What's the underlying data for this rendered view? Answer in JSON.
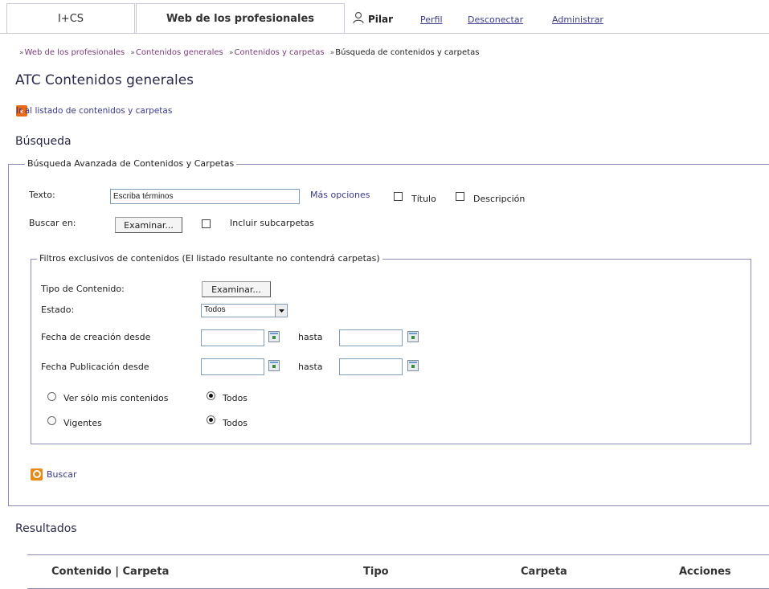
{
  "tabs": [
    {
      "label": "I+CS",
      "active": false
    },
    {
      "label": "Web de los profesionales",
      "active": true
    }
  ],
  "user": {
    "icon": "user-icon",
    "name": "Pilar"
  },
  "top_links": {
    "profile": "Perfil",
    "logout": "Desconectar",
    "admin": "Administrar"
  },
  "breadcrumb": {
    "separator": "»",
    "items": [
      "Web de los profesionales",
      "Contenidos generales",
      "Contenidos y carpetas",
      "Búsqueda de contenidos y carpetas"
    ]
  },
  "page_title": "ATC Contenidos generales",
  "back_link": "Ir al listado de contenidos y carpetas",
  "search_heading": "Búsqueda",
  "advanced": {
    "legend": "Búsqueda Avanzada de Contenidos y Carpetas",
    "text_label": "Texto:",
    "text_value": "Escriba términos",
    "more_options": "Más opciones",
    "title_check": "Título",
    "description_check": "Descripción",
    "search_in_label": "Buscar en:",
    "browse_button": "Examinar...",
    "include_subfolders": "Incluir subcarpetas"
  },
  "filters": {
    "legend": "Filtros exclusivos de contenidos (El listado resultante no contendrá carpetas)",
    "content_type_label": "Tipo de Contenido:",
    "content_type_button": "Examinar...",
    "status_label": "Estado:",
    "status_value": "Todos",
    "created_from_label": "Fecha de creación desde",
    "until_label": "hasta",
    "published_from_label": "Fecha Publicación desde",
    "only_mine": "Ver sólo mis contenidos",
    "all_1": "Todos",
    "current": "Vigentes",
    "all_2": "Todos"
  },
  "search_button": "Buscar",
  "results_heading": "Resultados",
  "results_columns": [
    "Contenido | Carpeta",
    "Tipo",
    "Carpeta",
    "Acciones"
  ],
  "colors": {
    "border": "#8b8bb8",
    "link": "#3b3b8c",
    "accent": "#e66a1a"
  }
}
